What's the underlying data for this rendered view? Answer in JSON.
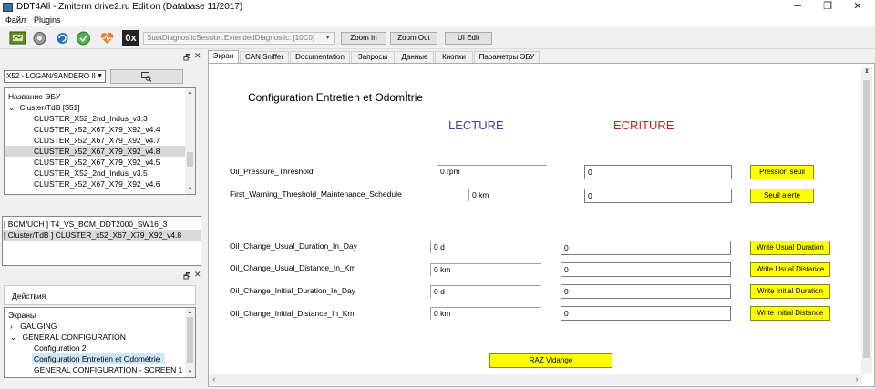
{
  "window": {
    "title": "DDT4All - Zmiterm drive2.ru Edition (Database 11/2017)"
  },
  "menu": {
    "items": [
      "Файл",
      "Plugins"
    ]
  },
  "toolbar": {
    "diag_session": "StartDiagnosticSession.ExtendedDiagnostic: [10C0]",
    "zoom_in": "Zoom In",
    "zoom_out": "Zoom Out",
    "ui_edit": "UI Edit",
    "hex_label": "0x"
  },
  "ecu_pane": {
    "vehicle": "X52 - LOGAN/SANDERO II",
    "header": "Название ЭБУ",
    "group": "Cluster/TdB [$51]",
    "items": [
      "CLUSTER_X52_2nd_Indus_v3.3",
      "CLUSTER_x52_X67_X79_X92_v4.4",
      "CLUSTER_x52_X67_X79_X92_v4.7",
      "CLUSTER_x52_X67_X79_X92_v4.8",
      "CLUSTER_x52_X67_X79_X92_v4.5",
      "CLUSTER_X52_2nd_Indus_v3.5",
      "CLUSTER_x52_X67_X79_X92_v4.6"
    ]
  },
  "connected": {
    "items": [
      "[ BCM/UCH ] T4_VS_BCM_DDT2000_SW16_3",
      "[ Cluster/TdB ] CLUSTER_x52_X67_X79_X92_v4.8"
    ]
  },
  "screens_pane": {
    "actions": "Действия",
    "header": "Экраны",
    "items": [
      {
        "label": "GAUGING",
        "expander": "›"
      },
      {
        "label": "GENERAL CONFIGURATION",
        "expander": "⌄"
      },
      {
        "label": "Configuration 2",
        "expander": ""
      },
      {
        "label": "Configuration Entretien et Odométrie",
        "expander": ""
      },
      {
        "label": "GENERAL CONFIGURATION - SCREEN 1",
        "expander": ""
      }
    ]
  },
  "tabs": [
    "Экран",
    "CAN Sniffer",
    "Documentation",
    "Запросы",
    "Данные",
    "Кнопки",
    "Параметры ЭБУ"
  ],
  "screen": {
    "title": "Configuration Entretien et OdomÌtrie",
    "read_header": "LECTURE",
    "write_header": "ECRITURE",
    "read_color": "#3f3f9f",
    "write_color": "#c02020",
    "button_color": "#ffff00",
    "rows": [
      {
        "label": "Oil_Pressure_Threshold",
        "read": "0 rpm",
        "write": "0",
        "button": "Pression seuil"
      },
      {
        "label": "First_Warning_Threshold_Maintenance_Schedule",
        "read": "0 km",
        "write": "0",
        "button": "Seuil alerte"
      },
      {
        "label": "Oil_Change_Usual_Duration_In_Day",
        "read": "0 d",
        "write": "0",
        "button": "Write Usual Duration"
      },
      {
        "label": "Oil_Change_Usual_Distance_In_Km",
        "read": "0 km",
        "write": "0",
        "button": "Write Usual Distance"
      },
      {
        "label": "Oil_Change_Initial_Duration_In_Day",
        "read": "0 d",
        "write": "0",
        "button": "Write Initial Duration"
      },
      {
        "label": "Oil_Change_Initial_Distance_In_Km",
        "read": "0 km",
        "write": "0",
        "button": "Write Initial Distance"
      }
    ],
    "reset_button": "RAZ Vidange"
  }
}
